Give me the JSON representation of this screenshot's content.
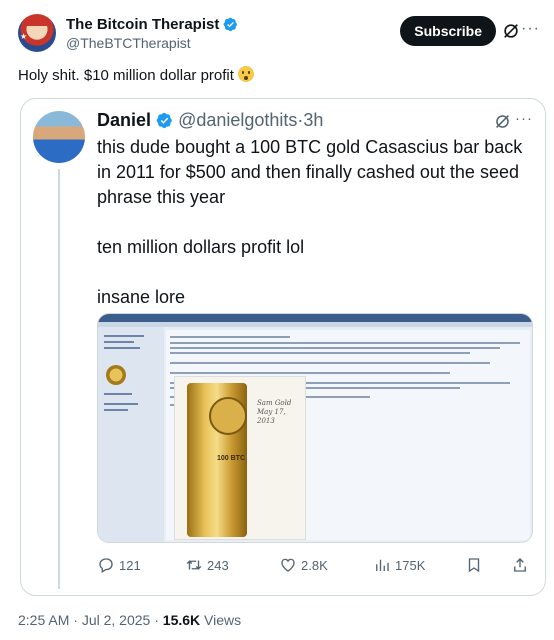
{
  "author": {
    "name": "The Bitcoin Therapist",
    "handle": "@TheBTCTherapist",
    "subscribe_label": "Subscribe"
  },
  "tweet": {
    "text": "Holy shit. $10 million dollar profit"
  },
  "quoted": {
    "name": "Daniel",
    "handle": "@danielgothits",
    "separator": "·",
    "time": "3h",
    "paragraphs": [
      "this dude bought a 100 BTC gold Casascius bar back in 2011 for $500 and then finally cashed out the seed phrase this year",
      "ten million dollars profit lol",
      "insane lore"
    ],
    "media": {
      "bar_text": "100 BTC",
      "signature": "Sam Gold May 17, 2013"
    },
    "stats": {
      "replies": "121",
      "reposts": "243",
      "likes": "2.8K",
      "views": "175K"
    }
  },
  "footer": {
    "time": "2:25 AM",
    "separator": "·",
    "date": "Jul 2, 2025",
    "separator2": "·",
    "views_count": "15.6K",
    "views_label": "Views"
  },
  "colors": {
    "verified": "#1d9bf0",
    "text_secondary": "#536471",
    "border": "#cfd9de"
  }
}
